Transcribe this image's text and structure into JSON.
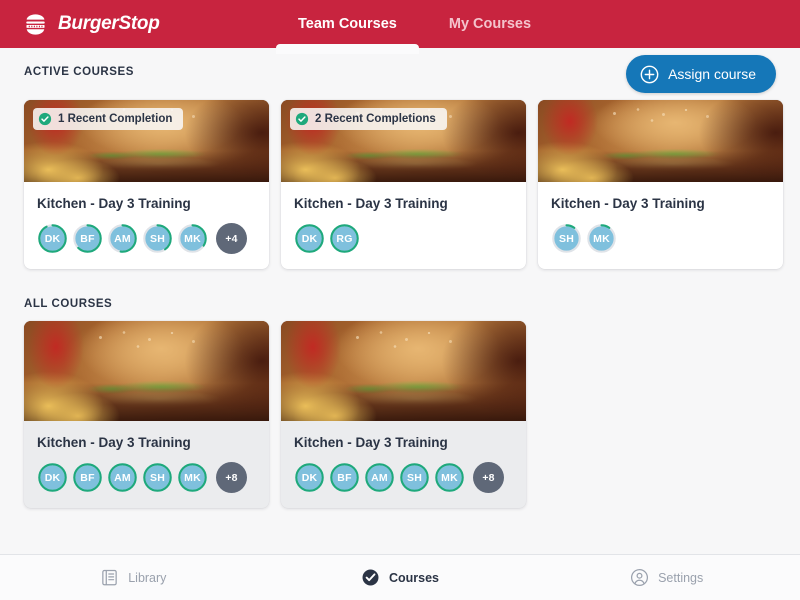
{
  "header": {
    "brand_name": "BurgerStop",
    "brand_icon": "burger-logo-icon",
    "brand_color": "#c8243f",
    "tabs": [
      {
        "label": "Team Courses",
        "active": true
      },
      {
        "label": "My Courses",
        "active": false
      }
    ]
  },
  "toolbar": {
    "assign_label": "Assign course",
    "assign_icon": "plus-circle-icon",
    "assign_color": "#1577b8"
  },
  "sections": [
    {
      "label": "ACTIVE COURSES",
      "cards": [
        {
          "badge": "1 Recent Completion",
          "badge_icon": "check-circle-icon",
          "title": "Kitchen - Day 3 Training",
          "image": "burger-photo",
          "avatars": [
            {
              "initials": "DK",
              "progress": 92
            },
            {
              "initials": "BF",
              "progress": 62
            },
            {
              "initials": "AM",
              "progress": 52
            },
            {
              "initials": "SH",
              "progress": 40
            },
            {
              "initials": "MK",
              "progress": 34
            }
          ],
          "overflow": "+4"
        },
        {
          "badge": "2 Recent Completions",
          "badge_icon": "check-circle-icon",
          "title": "Kitchen - Day 3 Training",
          "image": "burger-photo",
          "avatars": [
            {
              "initials": "DK",
              "progress": 100
            },
            {
              "initials": "RG",
              "progress": 100
            }
          ],
          "overflow": ""
        },
        {
          "badge": "",
          "badge_icon": "",
          "title": "Kitchen - Day 3 Training",
          "image": "burger-photo",
          "avatars": [
            {
              "initials": "SH",
              "progress": 10
            },
            {
              "initials": "MK",
              "progress": 10
            }
          ],
          "overflow": ""
        }
      ]
    },
    {
      "label": "ALL COURSES",
      "cards": [
        {
          "badge": "",
          "badge_icon": "",
          "title": "Kitchen - Day 3 Training",
          "image": "burger-photo",
          "avatars": [
            {
              "initials": "DK",
              "progress": 100
            },
            {
              "initials": "BF",
              "progress": 100
            },
            {
              "initials": "AM",
              "progress": 100
            },
            {
              "initials": "SH",
              "progress": 100
            },
            {
              "initials": "MK",
              "progress": 100
            }
          ],
          "overflow": "+8"
        },
        {
          "badge": "",
          "badge_icon": "",
          "title": "Kitchen - Day 3 Training",
          "image": "burger-photo",
          "avatars": [
            {
              "initials": "DK",
              "progress": 100
            },
            {
              "initials": "BF",
              "progress": 100
            },
            {
              "initials": "AM",
              "progress": 100
            },
            {
              "initials": "SH",
              "progress": 100
            },
            {
              "initials": "MK",
              "progress": 100
            }
          ],
          "overflow": "+8"
        }
      ]
    }
  ],
  "bottom_nav": [
    {
      "label": "Library",
      "icon": "book-icon",
      "active": false
    },
    {
      "label": "Courses",
      "icon": "check-circle-filled-icon",
      "active": true
    },
    {
      "label": "Settings",
      "icon": "account-circle-icon",
      "active": false
    }
  ],
  "colors": {
    "avatar_fill": "#7fc0dd",
    "ring_progress": "#1ea97c",
    "ring_track": "#dfe3e8",
    "overflow_fill": "#5f6878",
    "accent_blue": "#1577b8",
    "brand_red": "#c8243f"
  }
}
